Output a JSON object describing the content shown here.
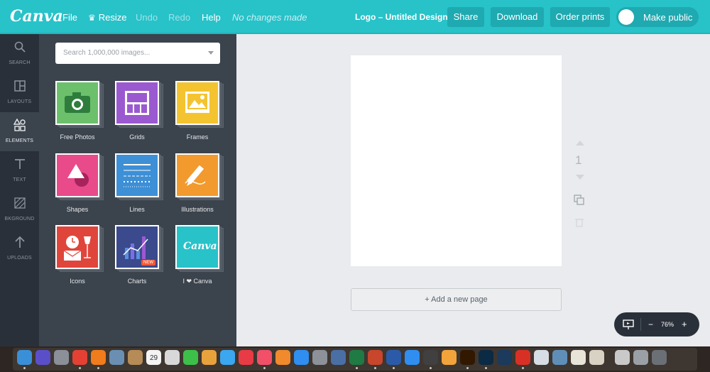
{
  "topbar": {
    "logo": "Canva",
    "menu": {
      "file": "File",
      "resize": "Resize",
      "undo": "Undo",
      "redo": "Redo",
      "help": "Help",
      "status": "No changes made"
    },
    "design_title": "Logo – Untitled Design",
    "buttons": {
      "share": "Share",
      "download": "Download",
      "order_prints": "Order prints"
    },
    "make_public": {
      "label": "Make public",
      "enabled": false
    }
  },
  "leftnav": {
    "items": [
      {
        "label": "SEARCH",
        "icon": "search-icon",
        "active": false
      },
      {
        "label": "LAYOUTS",
        "icon": "layouts-icon",
        "active": false
      },
      {
        "label": "ELEMENTS",
        "icon": "elements-icon",
        "active": true
      },
      {
        "label": "TEXT",
        "icon": "text-icon",
        "active": false
      },
      {
        "label": "BKGROUND",
        "icon": "background-icon",
        "active": false
      },
      {
        "label": "UPLOADS",
        "icon": "uploads-icon",
        "active": false
      }
    ]
  },
  "panel": {
    "search_placeholder": "Search 1,000,000 images...",
    "tiles": [
      {
        "label": "Free Photos",
        "color": "#6cc06b",
        "icon": "camera-icon"
      },
      {
        "label": "Grids",
        "color": "#9b59d0",
        "icon": "grid-icon"
      },
      {
        "label": "Frames",
        "color": "#f4c430",
        "icon": "frame-icon"
      },
      {
        "label": "Shapes",
        "color": "#e84a8a",
        "icon": "shapes-icon"
      },
      {
        "label": "Lines",
        "color": "#3d8fd6",
        "icon": "lines-icon"
      },
      {
        "label": "Illustrations",
        "color": "#f29a2e",
        "icon": "pencil-icon"
      },
      {
        "label": "Icons",
        "color": "#e0453b",
        "icon": "clock-glass-icon"
      },
      {
        "label": "Charts",
        "color": "#3a4a8c",
        "icon": "chart-icon",
        "badge": "NEW"
      },
      {
        "label": "I ❤ Canva",
        "color": "#28c2c9",
        "icon": "canva-logo-icon",
        "tile_text": "Canva"
      }
    ]
  },
  "canvas": {
    "page_number": "1",
    "add_page_label": "+ Add a new page",
    "zoom": {
      "minus": "−",
      "value": "76%",
      "plus": "+"
    }
  },
  "dock": {
    "calendar_day": "29",
    "apps": [
      {
        "name": "finder",
        "color": "#3a8fd9"
      },
      {
        "name": "siri",
        "color": "#5b4fc9"
      },
      {
        "name": "launchpad",
        "color": "#8a8f98"
      },
      {
        "name": "chrome",
        "color": "#e44134"
      },
      {
        "name": "firefox",
        "color": "#f07c1c"
      },
      {
        "name": "preview",
        "color": "#6a8fb3"
      },
      {
        "name": "notes-box",
        "color": "#b58b57"
      },
      {
        "name": "calendar",
        "color": "#f4f4f4"
      },
      {
        "name": "photos-viewer",
        "color": "#d8d8d8"
      },
      {
        "name": "facetime",
        "color": "#3cc04a"
      },
      {
        "name": "photos",
        "color": "#e8a23c"
      },
      {
        "name": "messages",
        "color": "#3aa7f0"
      },
      {
        "name": "news",
        "color": "#e83b45"
      },
      {
        "name": "music",
        "color": "#f25068"
      },
      {
        "name": "books",
        "color": "#f08a2c"
      },
      {
        "name": "app-store",
        "color": "#2f8ef0"
      },
      {
        "name": "system-prefs",
        "color": "#8d9199"
      },
      {
        "name": "proxy",
        "color": "#4a6fa5"
      },
      {
        "name": "excel",
        "color": "#1f7a43"
      },
      {
        "name": "powerpoint",
        "color": "#c8462b"
      },
      {
        "name": "word",
        "color": "#2b5ba8"
      },
      {
        "name": "safari",
        "color": "#2f8ef0"
      },
      {
        "name": "activity",
        "color": "#404040"
      },
      {
        "name": "istat",
        "color": "#f2a33a"
      },
      {
        "name": "illustrator",
        "color": "#331800"
      },
      {
        "name": "photoshop",
        "color": "#0b2a43"
      },
      {
        "name": "steam",
        "color": "#1b3a5c"
      },
      {
        "name": "acrobat",
        "color": "#d93025"
      },
      {
        "name": "cloud",
        "color": "#d7dde4"
      },
      {
        "name": "screenshot",
        "color": "#5f8fb8"
      },
      {
        "name": "text-edit",
        "color": "#e8e4d8"
      },
      {
        "name": "font-book",
        "color": "#d8d2c4"
      },
      {
        "name": "skitch",
        "color": "#c9c9c9"
      },
      {
        "name": "printer",
        "color": "#9aa0a6"
      },
      {
        "name": "trash",
        "color": "#6b7077"
      }
    ]
  }
}
